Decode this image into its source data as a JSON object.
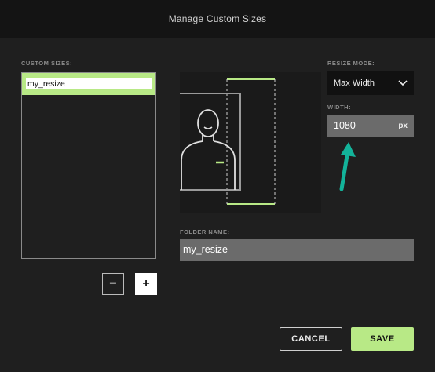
{
  "dialog": {
    "title": "Manage Custom Sizes"
  },
  "custom_sizes": {
    "label": "CUSTOM SIZES:",
    "items": [
      {
        "value": "my_resize",
        "selected": true
      }
    ],
    "remove_label": "−",
    "add_label": "+"
  },
  "resize_mode": {
    "label": "RESIZE MODE:",
    "value": "Max Width"
  },
  "width": {
    "label": "WIDTH:",
    "value": "1080",
    "unit": "px"
  },
  "folder": {
    "label": "FOLDER NAME:",
    "value": "my_resize"
  },
  "actions": {
    "cancel_label": "CANCEL",
    "save_label": "SAVE"
  },
  "colors": {
    "accent": "#b8e986",
    "annotation_arrow": "#13b39a",
    "background": "#1f1f1f",
    "titlebar": "#141414",
    "field": "#6b6b6b"
  },
  "icons": [
    "chevron-down-icon",
    "person-silhouette-icon",
    "annotation-arrow-icon"
  ]
}
